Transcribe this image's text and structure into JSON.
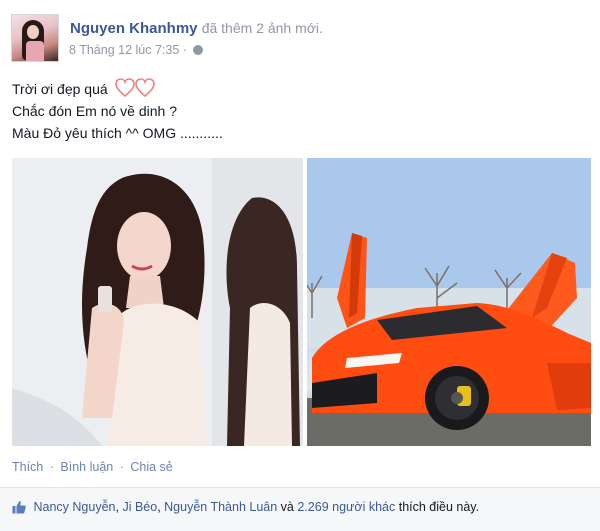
{
  "post": {
    "author": "Nguyen Khanhmy",
    "action": "đã thêm 2 ảnh mới.",
    "timestamp": "8 Tháng 12 lúc 7:35",
    "privacy_icon": "globe-icon",
    "text_line1": "Trời ơi đẹp quá",
    "text_line2": "Chắc đón Em nó về dinh ?",
    "text_line3": "Màu Đỏ yêu thích ^^ OMG ..........."
  },
  "photos": [
    {
      "alt": "photo-woman-white-dress"
    },
    {
      "alt": "photo-orange-lamborghini"
    }
  ],
  "actions": {
    "like": "Thích",
    "comment": "Bình luận",
    "share": "Chia sẻ",
    "separator": "·"
  },
  "likes": {
    "name1": "Nancy Nguyễn",
    "name2": "Ji Béo",
    "name3": "Nguyễn Thành Luân",
    "conj": " và ",
    "others": "2.269 người khác",
    "suffix": " thích điều này.",
    "comma": ", "
  },
  "colors": {
    "link": "#3b5998",
    "muted": "#9197a3",
    "heart": "#f08080",
    "car": "#ff4d12"
  }
}
